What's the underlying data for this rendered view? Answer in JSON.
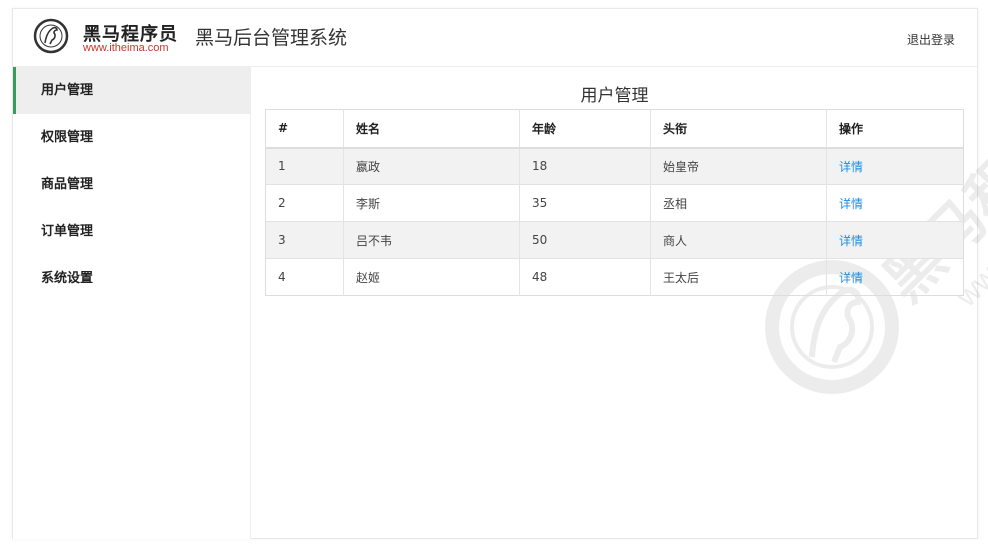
{
  "header": {
    "brand_cn": "黑马程序员",
    "brand_url": "www.itheima.com",
    "system_title": "黑马后台管理系统",
    "logout_label": "退出登录"
  },
  "sidebar": {
    "items": [
      {
        "label": "用户管理"
      },
      {
        "label": "权限管理"
      },
      {
        "label": "商品管理"
      },
      {
        "label": "订单管理"
      },
      {
        "label": "系统设置"
      }
    ]
  },
  "main": {
    "title": "用户管理",
    "columns": [
      "#",
      "姓名",
      "年龄",
      "头衔",
      "操作"
    ],
    "rows": [
      {
        "id": "1",
        "name": "嬴政",
        "age": "18",
        "title": "始皇帝",
        "action": "详情"
      },
      {
        "id": "2",
        "name": "李斯",
        "age": "35",
        "title": "丞相",
        "action": "详情"
      },
      {
        "id": "3",
        "name": "吕不韦",
        "age": "50",
        "title": "商人",
        "action": "详情"
      },
      {
        "id": "4",
        "name": "赵姬",
        "age": "48",
        "title": "王太后",
        "action": "详情"
      }
    ]
  },
  "colors": {
    "accent": "#3a9b5e",
    "link": "#1e8ee0",
    "brand_red": "#c0392b"
  }
}
